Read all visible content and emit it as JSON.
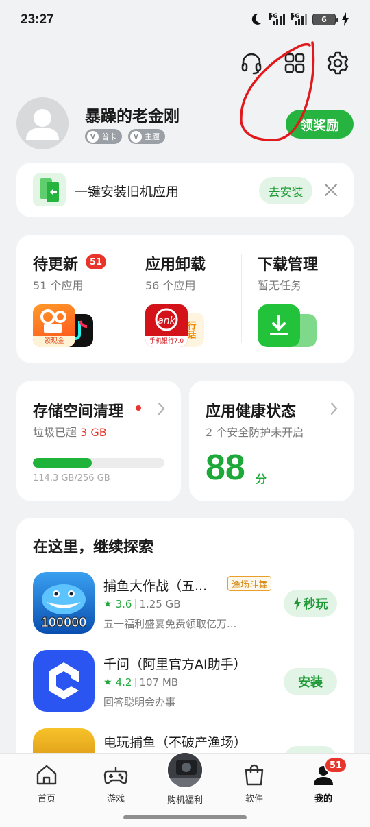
{
  "status_bar": {
    "time": "23:27",
    "network_1": "5G",
    "network_2": "5G",
    "battery": "6",
    "icons": [
      "moon-icon",
      "signal-icon",
      "battery-icon",
      "charging-icon"
    ]
  },
  "header": {
    "icons": [
      "headset-icon",
      "apps-grid-icon",
      "gear-icon"
    ]
  },
  "profile": {
    "username": "暴躁的老金刚",
    "badge_card": "普卡",
    "badge_theme": "主题",
    "reward_button": "领奖励"
  },
  "install_banner": {
    "text": "一键安装旧机应用",
    "button": "去安装"
  },
  "manage": {
    "updates": {
      "title": "待更新",
      "badge": "51",
      "subtitle": "51 个应用",
      "thumb_caption": "领现金"
    },
    "uninstall": {
      "title": "应用卸载",
      "subtitle": "56 个应用",
      "thumb_caption": "手机银行7.0",
      "thumb_side": "行话"
    },
    "downloads": {
      "title": "下载管理",
      "subtitle": "暂无任务"
    }
  },
  "storage": {
    "title": "存储空间清理",
    "subtitle_prefix": "垃圾已超 ",
    "subtitle_value": "3 GB",
    "used_fraction": 0.447,
    "usage_label": "114.3 GB/256 GB"
  },
  "health": {
    "title": "应用健康状态",
    "subtitle": "2 个安全防护未开启",
    "score": "88",
    "score_unit": "分"
  },
  "explore": {
    "title": "在这里，继续探索",
    "apps": [
      {
        "name": "捕鱼大作战（五...",
        "tag": "渔场斗舞",
        "rating": "3.6",
        "size": "1.25 GB",
        "desc": "五一福利盛宴免费领取亿万...",
        "action": "秒玩",
        "icon_text": "100000"
      },
      {
        "name": "千问（阿里官方AI助手）",
        "rating": "4.2",
        "size": "107 MB",
        "desc": "回答聪明会办事",
        "action": "安装"
      },
      {
        "name": "电玩捕鱼（不破产渔场）"
      }
    ]
  },
  "bottom_nav": {
    "items": [
      {
        "label": "首页",
        "icon": "home-icon"
      },
      {
        "label": "游戏",
        "icon": "gamepad-icon"
      },
      {
        "label": "购机福利",
        "icon": "phone-deal-icon"
      },
      {
        "label": "软件",
        "icon": "bag-icon"
      },
      {
        "label": "我的",
        "icon": "person-icon"
      }
    ],
    "profile_badge": "51"
  },
  "colors": {
    "accent_green": "#27b33f",
    "badge_red": "#e8352b",
    "annotation_red": "#e0191c"
  }
}
